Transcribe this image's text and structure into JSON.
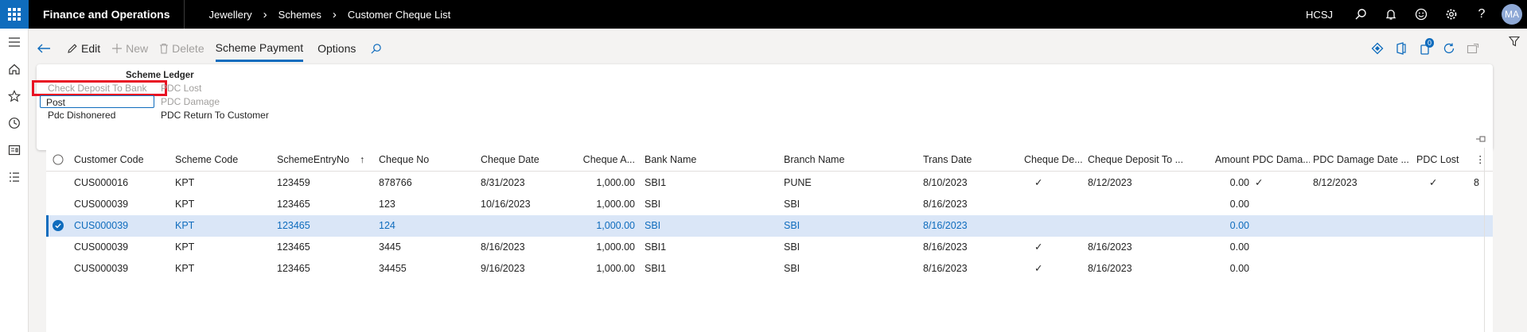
{
  "topbar": {
    "app_title": "Finance and Operations",
    "breadcrumbs": [
      "Jewellery",
      "Schemes",
      "Customer Cheque List"
    ],
    "company": "HCSJ",
    "avatar_initials": "MA",
    "icons": [
      "search-icon",
      "bell-icon",
      "smiley-icon",
      "gear-icon",
      "help-icon"
    ]
  },
  "leftnav": {
    "icons": [
      "hamburger-icon",
      "home-icon",
      "star-icon",
      "clock-icon",
      "workspace-icon",
      "list-icon"
    ]
  },
  "actionpane": {
    "edit": "Edit",
    "new": "New",
    "delete": "Delete",
    "tab_scheme_payment": "Scheme Payment",
    "tab_options": "Options",
    "badge_count": "0"
  },
  "ribbon": {
    "group_title": "Scheme Ledger",
    "buttons": {
      "check_deposit": "Check Deposit To Bank",
      "post": "Post",
      "pdc_dishonered": "Pdc Dishonered",
      "pdc_lost": "PDC Lost",
      "pdc_damage": "PDC Damage",
      "pdc_return": "PDC Return To Customer"
    }
  },
  "grid": {
    "headers": [
      "Customer Code",
      "Scheme Code",
      "SchemeEntryNo",
      "Cheque No",
      "Cheque Date",
      "Cheque A...",
      "Bank Name",
      "Branch Name",
      "Trans Date",
      "Cheque De...",
      "Cheque Deposit To ...",
      "Amount",
      "PDC Dama...",
      "PDC Damage Date ...",
      "PDC Lost"
    ],
    "sort_indicator": "↑",
    "rows": [
      {
        "customer": "CUS000016",
        "scheme": "KPT",
        "entry": "123459",
        "cheque_no": "878766",
        "cheque_date": "8/31/2023",
        "cheque_amt": "1,000.00",
        "bank": "SBI1",
        "branch": "PUNE",
        "trans_date": "8/10/2023",
        "cheque_dep": "✓",
        "dep_date": "8/12/2023",
        "amount": "0.00",
        "pdc_damage": "✓",
        "pdc_damage_date": "8/12/2023",
        "pdc_lost": "✓",
        "overflow": "8"
      },
      {
        "customer": "CUS000039",
        "scheme": "KPT",
        "entry": "123465",
        "cheque_no": "123",
        "cheque_date": "10/16/2023",
        "cheque_amt": "1,000.00",
        "bank": "SBI",
        "branch": "SBI",
        "trans_date": "8/16/2023",
        "cheque_dep": "",
        "dep_date": "",
        "amount": "0.00",
        "pdc_damage": "",
        "pdc_damage_date": "",
        "pdc_lost": "",
        "overflow": ""
      },
      {
        "customer": "CUS000039",
        "scheme": "KPT",
        "entry": "123465",
        "cheque_no": "124",
        "cheque_date": "",
        "cheque_amt": "1,000.00",
        "bank": "SBI",
        "branch": "SBI",
        "trans_date": "8/16/2023",
        "cheque_dep": "",
        "dep_date": "",
        "amount": "0.00",
        "pdc_damage": "",
        "pdc_damage_date": "",
        "pdc_lost": "",
        "overflow": ""
      },
      {
        "customer": "CUS000039",
        "scheme": "KPT",
        "entry": "123465",
        "cheque_no": "3445",
        "cheque_date": "8/16/2023",
        "cheque_amt": "1,000.00",
        "bank": "SBI1",
        "branch": "SBI",
        "trans_date": "8/16/2023",
        "cheque_dep": "✓",
        "dep_date": "8/16/2023",
        "amount": "0.00",
        "pdc_damage": "",
        "pdc_damage_date": "",
        "pdc_lost": "",
        "overflow": ""
      },
      {
        "customer": "CUS000039",
        "scheme": "KPT",
        "entry": "123465",
        "cheque_no": "34455",
        "cheque_date": "9/16/2023",
        "cheque_amt": "1,000.00",
        "bank": "SBI1",
        "branch": "SBI",
        "trans_date": "8/16/2023",
        "cheque_dep": "✓",
        "dep_date": "8/16/2023",
        "amount": "0.00",
        "pdc_damage": "",
        "pdc_damage_date": "",
        "pdc_lost": "",
        "overflow": ""
      }
    ]
  },
  "colors": {
    "accent": "#0f6cbd",
    "selected_row": "#dae6f7",
    "highlight_box": "#e81123"
  }
}
